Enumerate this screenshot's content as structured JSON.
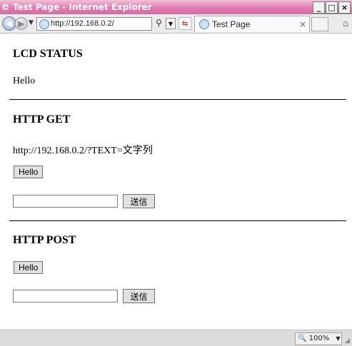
{
  "window": {
    "title": "Test Page - Internet Explorer",
    "ie_logo": "e",
    "minimize": "_",
    "maximize": "□",
    "close": "×"
  },
  "navbar": {
    "address": "http://192.168.0.2/",
    "tab_title": "Test Page",
    "tab_close": "×"
  },
  "content": {
    "lcd_heading": "LCD STATUS",
    "lcd_value": "Hello",
    "get_heading": "HTTP GET",
    "get_example_url": "http://192.168.0.2/?TEXT=文字列",
    "get_hello_button": "Hello",
    "get_text_value": "",
    "get_send_button": "送信",
    "post_heading": "HTTP POST",
    "post_hello_button": "Hello",
    "post_text_value": "",
    "post_send_button": "送信"
  },
  "statusbar": {
    "zoom": "100%"
  }
}
